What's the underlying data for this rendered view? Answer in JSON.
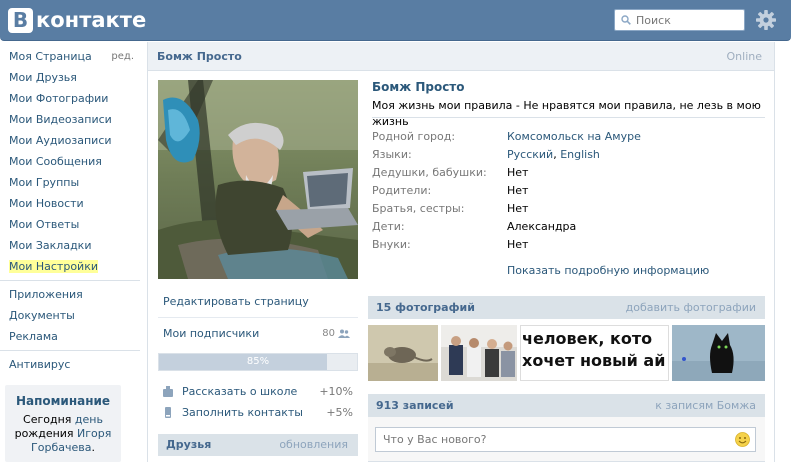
{
  "header": {
    "logo_letter": "В",
    "logo_text": "контакте",
    "search_placeholder": "Поиск"
  },
  "left_menu": {
    "edit_label": "ред.",
    "items": [
      {
        "label": "Моя Страница"
      },
      {
        "label": "Мои Друзья"
      },
      {
        "label": "Мои Фотографии"
      },
      {
        "label": "Мои Видеозаписи"
      },
      {
        "label": "Мои Аудиозаписи"
      },
      {
        "label": "Мои Сообщения"
      },
      {
        "label": "Мои Группы"
      },
      {
        "label": "Мои Новости"
      },
      {
        "label": "Мои Ответы"
      },
      {
        "label": "Мои Закладки"
      },
      {
        "label": "Мои Настройки"
      }
    ],
    "extra_items": [
      {
        "label": "Приложения"
      },
      {
        "label": "Документы"
      },
      {
        "label": "Реклама"
      }
    ],
    "antivirus": "Антивирус"
  },
  "reminder": {
    "title": "Напоминание",
    "today": "Сегодня",
    "day": "день",
    "birthday": "рождения",
    "name_first": "Игоря",
    "name_last": "Горбачева",
    "period": "."
  },
  "profile": {
    "name": "Бомж Просто",
    "online": "Online",
    "status": "Моя жизнь мои правила - Не нравятся мои правила, не лезь в мою жизнь",
    "fields": [
      {
        "key": "Родной город:",
        "value": "Комсомольск на Амуре",
        "link": true
      },
      {
        "key": "Языки:",
        "value": "Русский",
        "value2": "English",
        "link": true
      },
      {
        "key": "Дедушки, бабушки:",
        "value": "Нет",
        "link": false
      },
      {
        "key": "Родители:",
        "value": "Нет",
        "link": false
      },
      {
        "key": "Братья, сестры:",
        "value": "Нет",
        "link": false
      },
      {
        "key": "Дети:",
        "value": "Александра",
        "link": false
      },
      {
        "key": "Внуки:",
        "value": "Нет",
        "link": false
      }
    ],
    "more_info": "Показать подробную информацию"
  },
  "actions": {
    "edit_page": "Редактировать страницу",
    "subscribers": "Мои подписчики",
    "subscribers_count": "80",
    "progress_text": "85%",
    "progress_value": 85,
    "todo": [
      {
        "label": "Рассказать о школе",
        "pct": "+10%"
      },
      {
        "label": "Заполнить контакты",
        "pct": "+5%"
      }
    ]
  },
  "friends": {
    "title": "Друзья",
    "updates": "обновления"
  },
  "photos": {
    "title": "15 фотографий",
    "add": "добавить фотографии",
    "meme_line1": "человек, кото",
    "meme_line2": "хочет новый ай"
  },
  "wall": {
    "title": "913 записей",
    "to_wall": "к записям Бомжа",
    "placeholder": "Что у Вас нового?"
  },
  "colors": {
    "header": "#597DA3",
    "link": "#2B587A",
    "bar": "#DAE2E8",
    "highlight": "#FFFF99"
  }
}
